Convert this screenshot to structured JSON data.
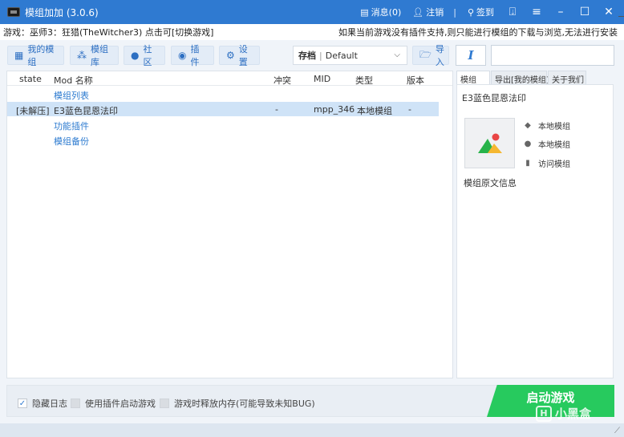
{
  "window": {
    "title": "模组加加 (3.0.6)",
    "messages": "消息(0)",
    "logout": "注销",
    "separator": "|",
    "signin": "签到"
  },
  "info": {
    "game_text": "游戏：巫师3：狂猎(TheWitcher3) 点击可[切换游戏]",
    "notice": "如果当前游戏没有插件支持,则只能进行模组的下载与浏览,无法进行安装"
  },
  "toolbar": {
    "my_mods": "我的模组",
    "mod_library": "模组库",
    "community": "社区",
    "plugins": "插件",
    "settings": "设置",
    "save_label": "存档",
    "save_value": "Default",
    "import": "导入",
    "italic_glyph": "I"
  },
  "table": {
    "headers": {
      "state": "state",
      "name": "Mod 名称",
      "conflict": "冲突",
      "mid": "MID",
      "type": "类型",
      "version": "版本"
    },
    "group_mod_list": "模组列表",
    "row": {
      "state": "[未解压]",
      "name": "E3蓝色昆恩法印",
      "conflict": "-",
      "mid": "mpp_346",
      "type": "本地模组",
      "version": "-"
    },
    "group_function_plugins": "功能插件",
    "group_mod_backup": "模组备份"
  },
  "side": {
    "tabs": [
      "模组",
      "导出[我的模组]",
      "关于我们"
    ],
    "mod_title": "E3蓝色昆恩法印",
    "category": "本地模组",
    "author": "本地模组",
    "visit": "访问模组",
    "original_info": "模组原文信息"
  },
  "bottom": {
    "hide_log": "隐藏日志",
    "use_plugin_launch": "使用插件启动游戏",
    "free_memory": "游戏时释放内存(可能导致未知BUG)",
    "start_game": "启动游戏",
    "watermark": "小黑盒"
  },
  "colors": {
    "titlebar": "#2f7ad1",
    "accent": "#2d7bd0",
    "start_button": "#27ca5e",
    "selected_row": "#cfe3f7"
  }
}
